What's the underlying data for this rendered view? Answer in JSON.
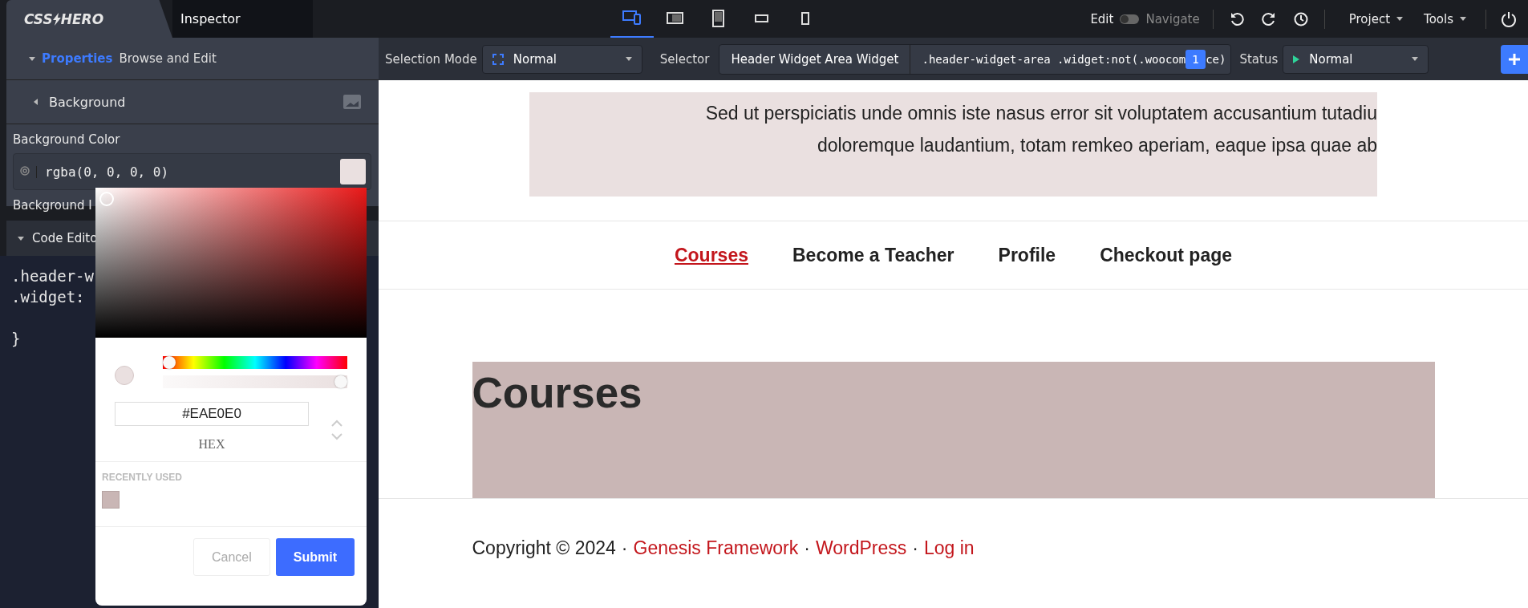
{
  "logo": {
    "left": "CSS",
    "right": "HERO"
  },
  "inspector_tab": {
    "label": "Inspector"
  },
  "device_modes": [
    {
      "kind": "responsive",
      "selected": true
    },
    {
      "kind": "tablet-landscape",
      "selected": false
    },
    {
      "kind": "tablet",
      "selected": false
    },
    {
      "kind": "phone-landscape",
      "selected": false
    },
    {
      "kind": "phone",
      "selected": false
    }
  ],
  "mode_toggle": {
    "left": "Edit",
    "right": "Navigate",
    "on": false
  },
  "menus": [
    "Project",
    "Tools"
  ],
  "properties_panel": {
    "title": "Properties",
    "subtitle": "Browse and Edit",
    "expanded": true
  },
  "section": {
    "title": "Background",
    "expanded": false
  },
  "fields": [
    {
      "label": "Background Color",
      "value": "rgba(0, 0, 0, 0)"
    },
    {
      "label": "Background I"
    }
  ],
  "code_editor": {
    "title": "Code Edito",
    "expanded": true,
    "lines": [
      ".header-w",
      ".widget:",
      "}"
    ]
  },
  "toolbar": {
    "selection_mode_label": "Selection Mode",
    "selection_mode": "Normal",
    "selector_label": "Selector",
    "selector_name": "Header Widget Area Widget",
    "selector_path": ".header-widget-area .widget:not(.woocom",
    "match_count": "1",
    "selector_path_tail": "ce)",
    "status_label": "Status",
    "status": "Normal"
  },
  "color_picker": {
    "hue": {
      "level": 0
    },
    "alpha": {
      "level": 1
    },
    "hex": "#EAE0E0",
    "format": "HEX",
    "recent_label": "RECENTLY USED",
    "recent": [
      {
        "color": "#c9b6b5"
      }
    ],
    "buttons": [
      {
        "label": "Cancel",
        "kind": "secondary"
      },
      {
        "label": "Submit",
        "kind": "primary"
      }
    ]
  },
  "site": {
    "intro_lines": [
      "Sed ut perspiciatis unde omnis iste nasus error sit voluptatem accusantium tutadiu",
      "doloremque laudantium, totam remkeo aperiam, eaque ipsa quae ab"
    ],
    "nav": [
      {
        "label": "Courses",
        "selected": true
      },
      {
        "label": "Become a Teacher",
        "selected": false
      },
      {
        "label": "Profile",
        "selected": false
      },
      {
        "label": "Checkout page",
        "selected": false
      }
    ],
    "heading": "Courses",
    "footer": {
      "text": "Copyright © 2024",
      "separator": "·",
      "links": [
        "Genesis Framework",
        "WordPress",
        "Log in"
      ]
    }
  }
}
